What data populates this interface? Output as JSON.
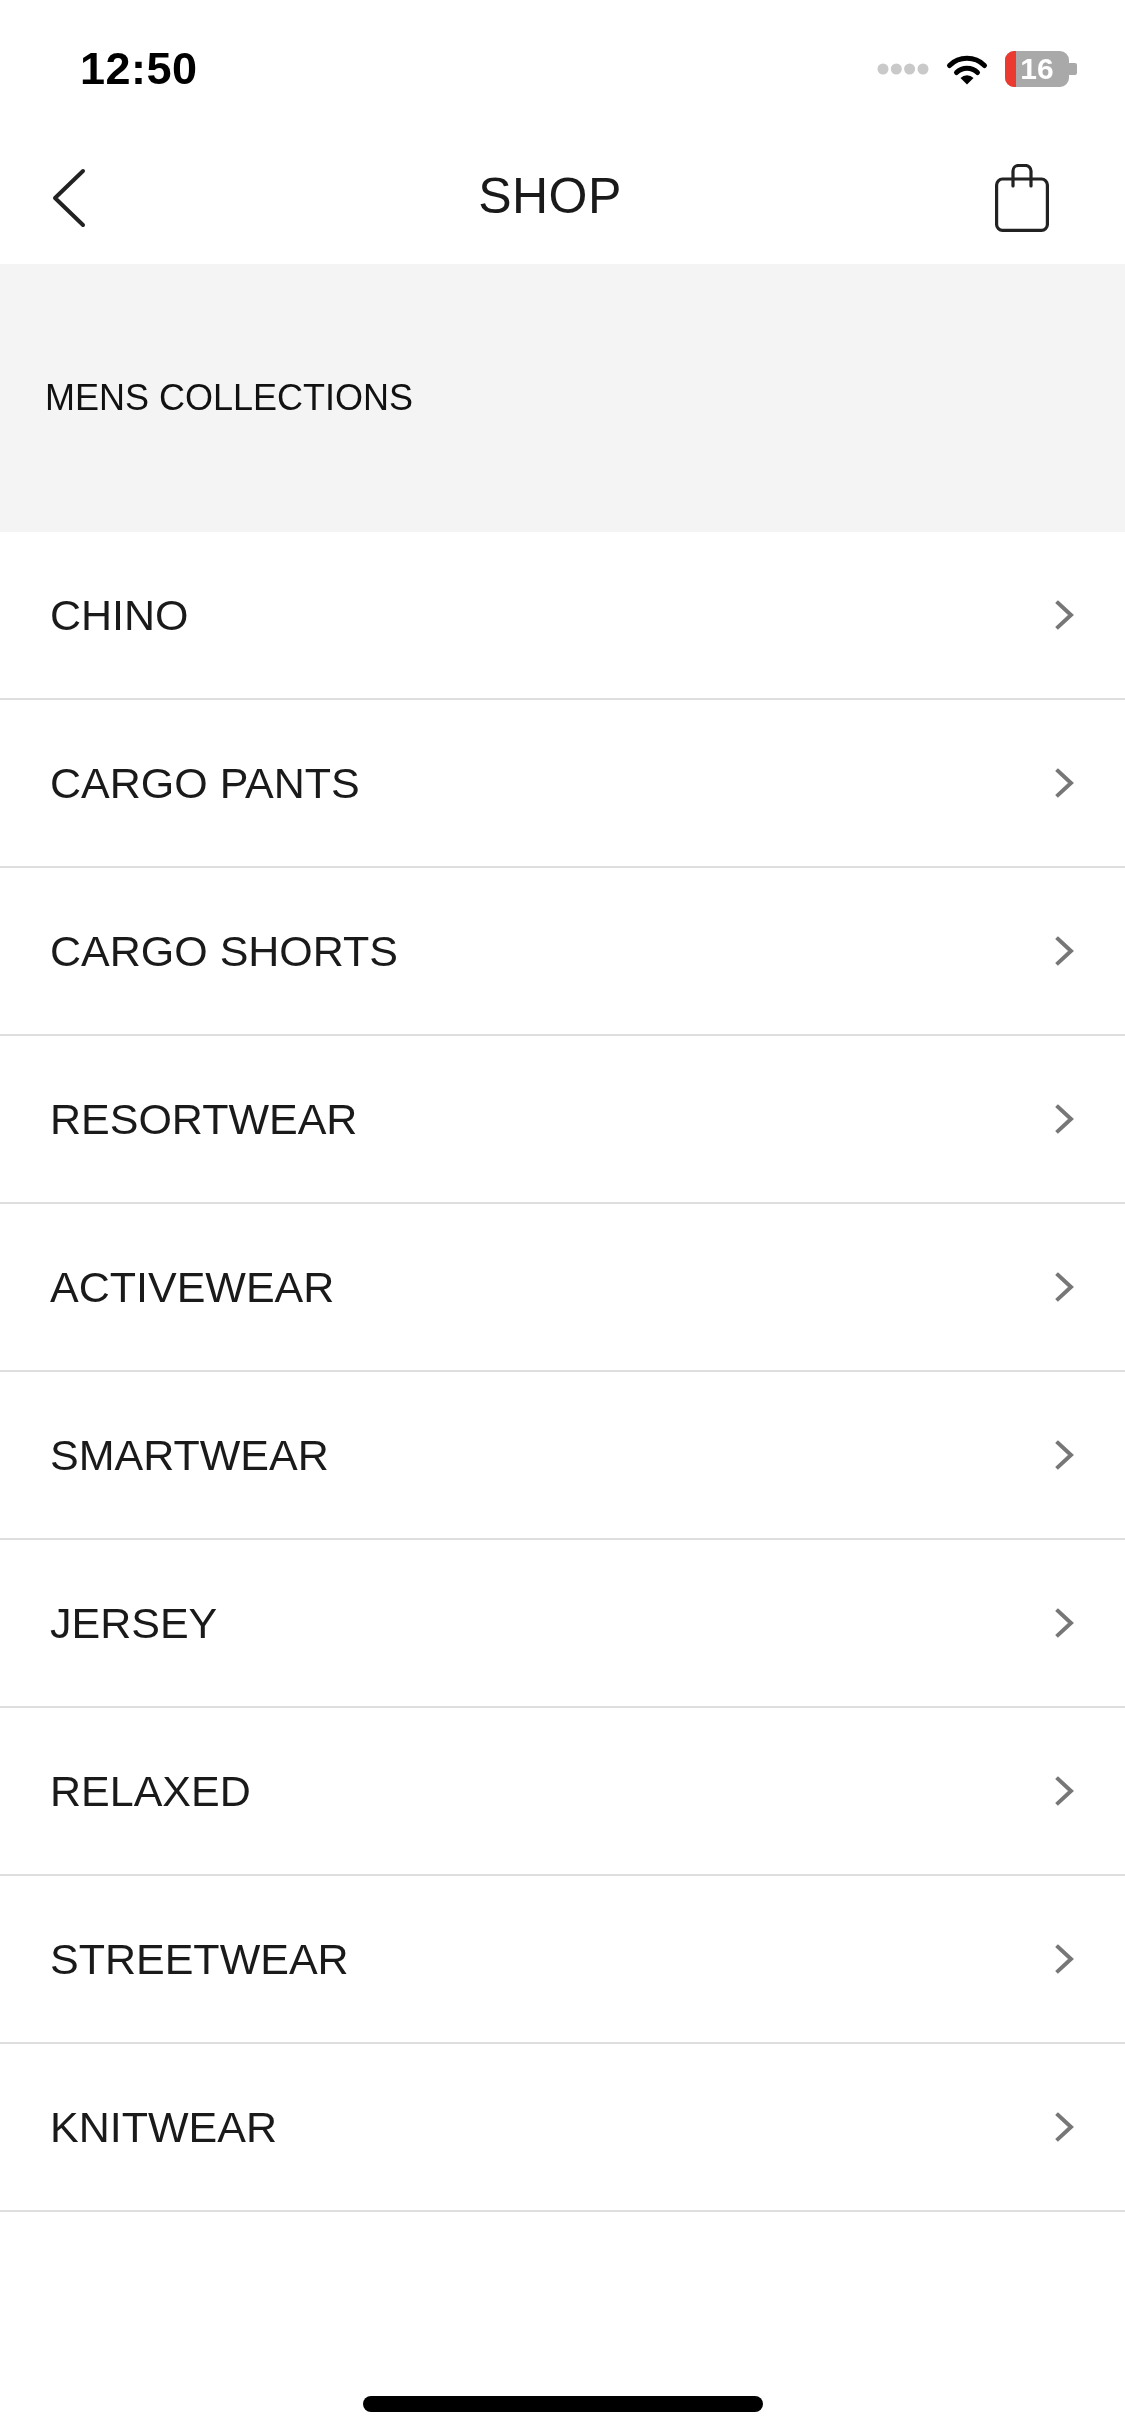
{
  "status_bar": {
    "time": "12:50",
    "battery_percent": "16"
  },
  "nav_bar": {
    "title": "SHOP"
  },
  "section": {
    "title": "MENS COLLECTIONS"
  },
  "items": [
    {
      "label": "CHINO"
    },
    {
      "label": "CARGO PANTS"
    },
    {
      "label": "CARGO SHORTS"
    },
    {
      "label": "RESORTWEAR"
    },
    {
      "label": "ACTIVEWEAR"
    },
    {
      "label": "SMARTWEAR"
    },
    {
      "label": "JERSEY"
    },
    {
      "label": "RELAXED"
    },
    {
      "label": "STREETWEAR"
    },
    {
      "label": "KNITWEAR"
    }
  ]
}
